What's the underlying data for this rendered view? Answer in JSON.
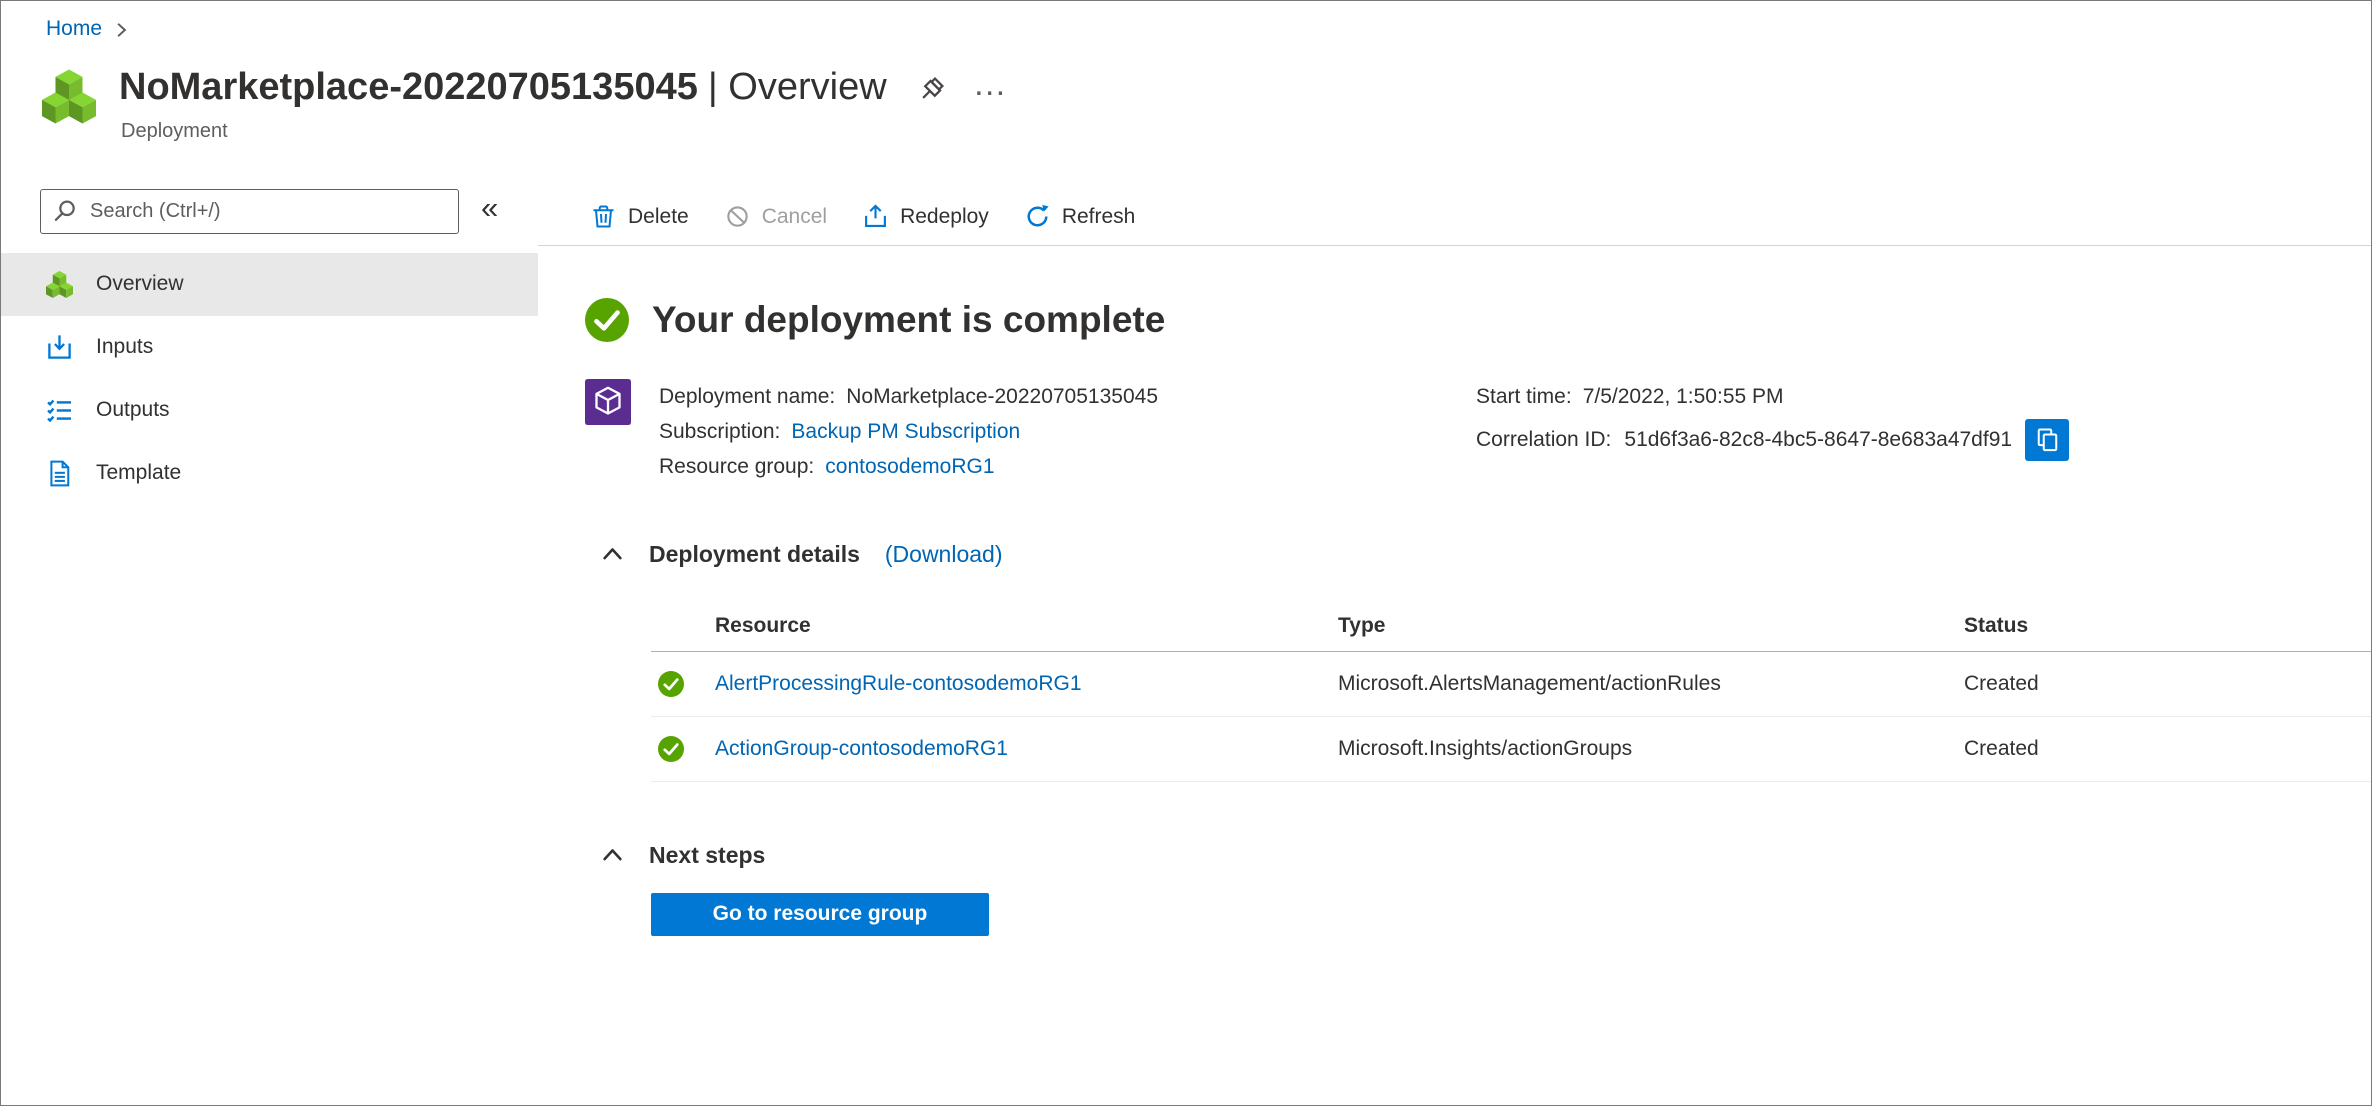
{
  "breadcrumb": {
    "items": [
      {
        "label": "Home"
      }
    ]
  },
  "header": {
    "title": "NoMarketplace-20220705135045",
    "title_suffix": "| Overview",
    "subtitle": "Deployment",
    "more_label": "…"
  },
  "sidebar": {
    "search_placeholder": "Search (Ctrl+/)",
    "collapse_glyph": "«",
    "items": [
      {
        "label": "Overview",
        "icon": "deployment-cubes-icon",
        "selected": true
      },
      {
        "label": "Inputs",
        "icon": "inputs-icon",
        "selected": false
      },
      {
        "label": "Outputs",
        "icon": "outputs-icon",
        "selected": false
      },
      {
        "label": "Template",
        "icon": "template-icon",
        "selected": false
      }
    ]
  },
  "toolbar": {
    "buttons": [
      {
        "label": "Delete",
        "icon": "trash-icon",
        "enabled": true
      },
      {
        "label": "Cancel",
        "icon": "cancel-icon",
        "enabled": false
      },
      {
        "label": "Redeploy",
        "icon": "redeploy-icon",
        "enabled": true
      },
      {
        "label": "Refresh",
        "icon": "refresh-icon",
        "enabled": true
      }
    ]
  },
  "main": {
    "status_heading": "Your deployment is complete",
    "overview": {
      "deployment_name_label": "Deployment name:",
      "deployment_name": "NoMarketplace-20220705135045",
      "subscription_label": "Subscription:",
      "subscription": "Backup PM Subscription",
      "resource_group_label": "Resource group:",
      "resource_group": "contosodemoRG1",
      "start_time_label": "Start time:",
      "start_time": "7/5/2022, 1:50:55 PM",
      "correlation_id_label": "Correlation ID:",
      "correlation_id": "51d6f3a6-82c8-4bc5-8647-8e683a47df91"
    },
    "deployment_details": {
      "title": "Deployment details",
      "download": "(Download)"
    },
    "table": {
      "columns": [
        "Resource",
        "Type",
        "Status"
      ],
      "rows": [
        {
          "resource": "AlertProcessingRule-contosodemoRG1",
          "type": "Microsoft.AlertsManagement/actionRules",
          "status": "Created"
        },
        {
          "resource": "ActionGroup-contosodemoRG1",
          "type": "Microsoft.Insights/actionGroups",
          "status": "Created"
        }
      ]
    },
    "next_steps": {
      "title": "Next steps",
      "go_button": "Go to resource group"
    }
  },
  "colors": {
    "link": "#0065b3",
    "accent_blue": "#0078d4",
    "success_green": "#57a300",
    "arm_purple": "#5c2d91"
  }
}
